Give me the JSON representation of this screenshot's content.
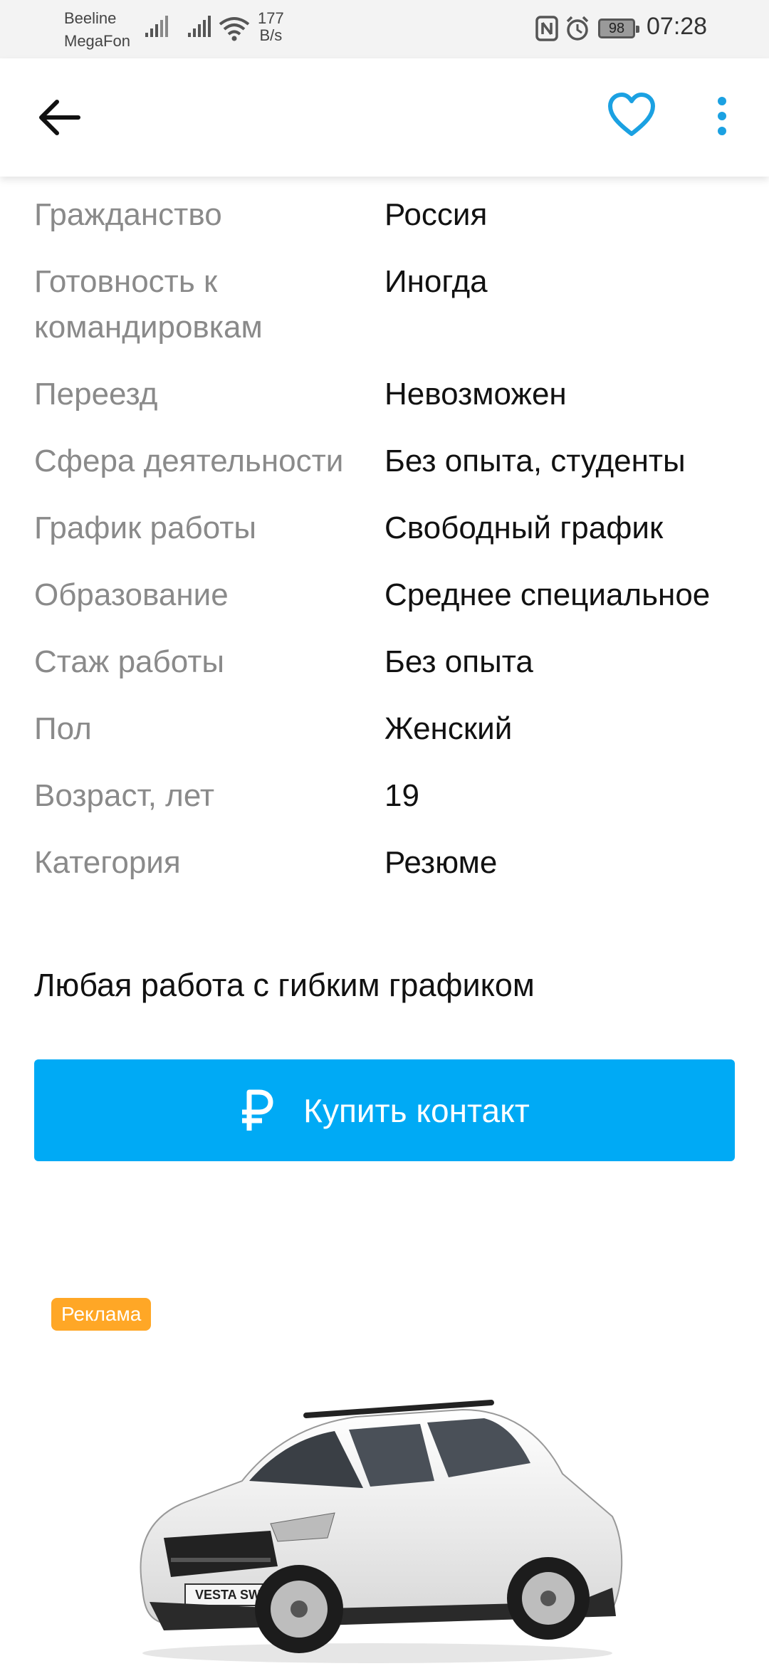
{
  "status_bar": {
    "carrier1": "Beeline",
    "carrier2": "MegaFon",
    "net_speed_value": "177",
    "net_speed_unit": "B/s",
    "battery": "98",
    "time": "07:28"
  },
  "app_bar": {
    "icons": [
      "arrow-left-icon",
      "heart-outline-icon",
      "more-vert-icon"
    ],
    "accent_color": "#1ba1e2"
  },
  "details": [
    {
      "label": "Гражданство",
      "value": "Россия"
    },
    {
      "label": "Готовность к командировкам",
      "value": "Иногда"
    },
    {
      "label": "Переезд",
      "value": "Невозможен"
    },
    {
      "label": "Сфера деятельности",
      "value": "Без опыта, студенты"
    },
    {
      "label": "График работы",
      "value": "Свободный график"
    },
    {
      "label": "Образование",
      "value": "Среднее специальное"
    },
    {
      "label": "Стаж работы",
      "value": "Без опыта"
    },
    {
      "label": "Пол",
      "value": "Женский"
    },
    {
      "label": "Возраст, лет",
      "value": "19"
    },
    {
      "label": "Категория",
      "value": "Резюме"
    }
  ],
  "description": "Любая работа с гибким графиком",
  "buy_button": {
    "label": "Купить контакт",
    "icon": "ruble-icon",
    "color": "#00aaf5"
  },
  "ad": {
    "badge": "Реклама",
    "badge_color": "#ffa726",
    "plate_text": "VESTA SW"
  }
}
